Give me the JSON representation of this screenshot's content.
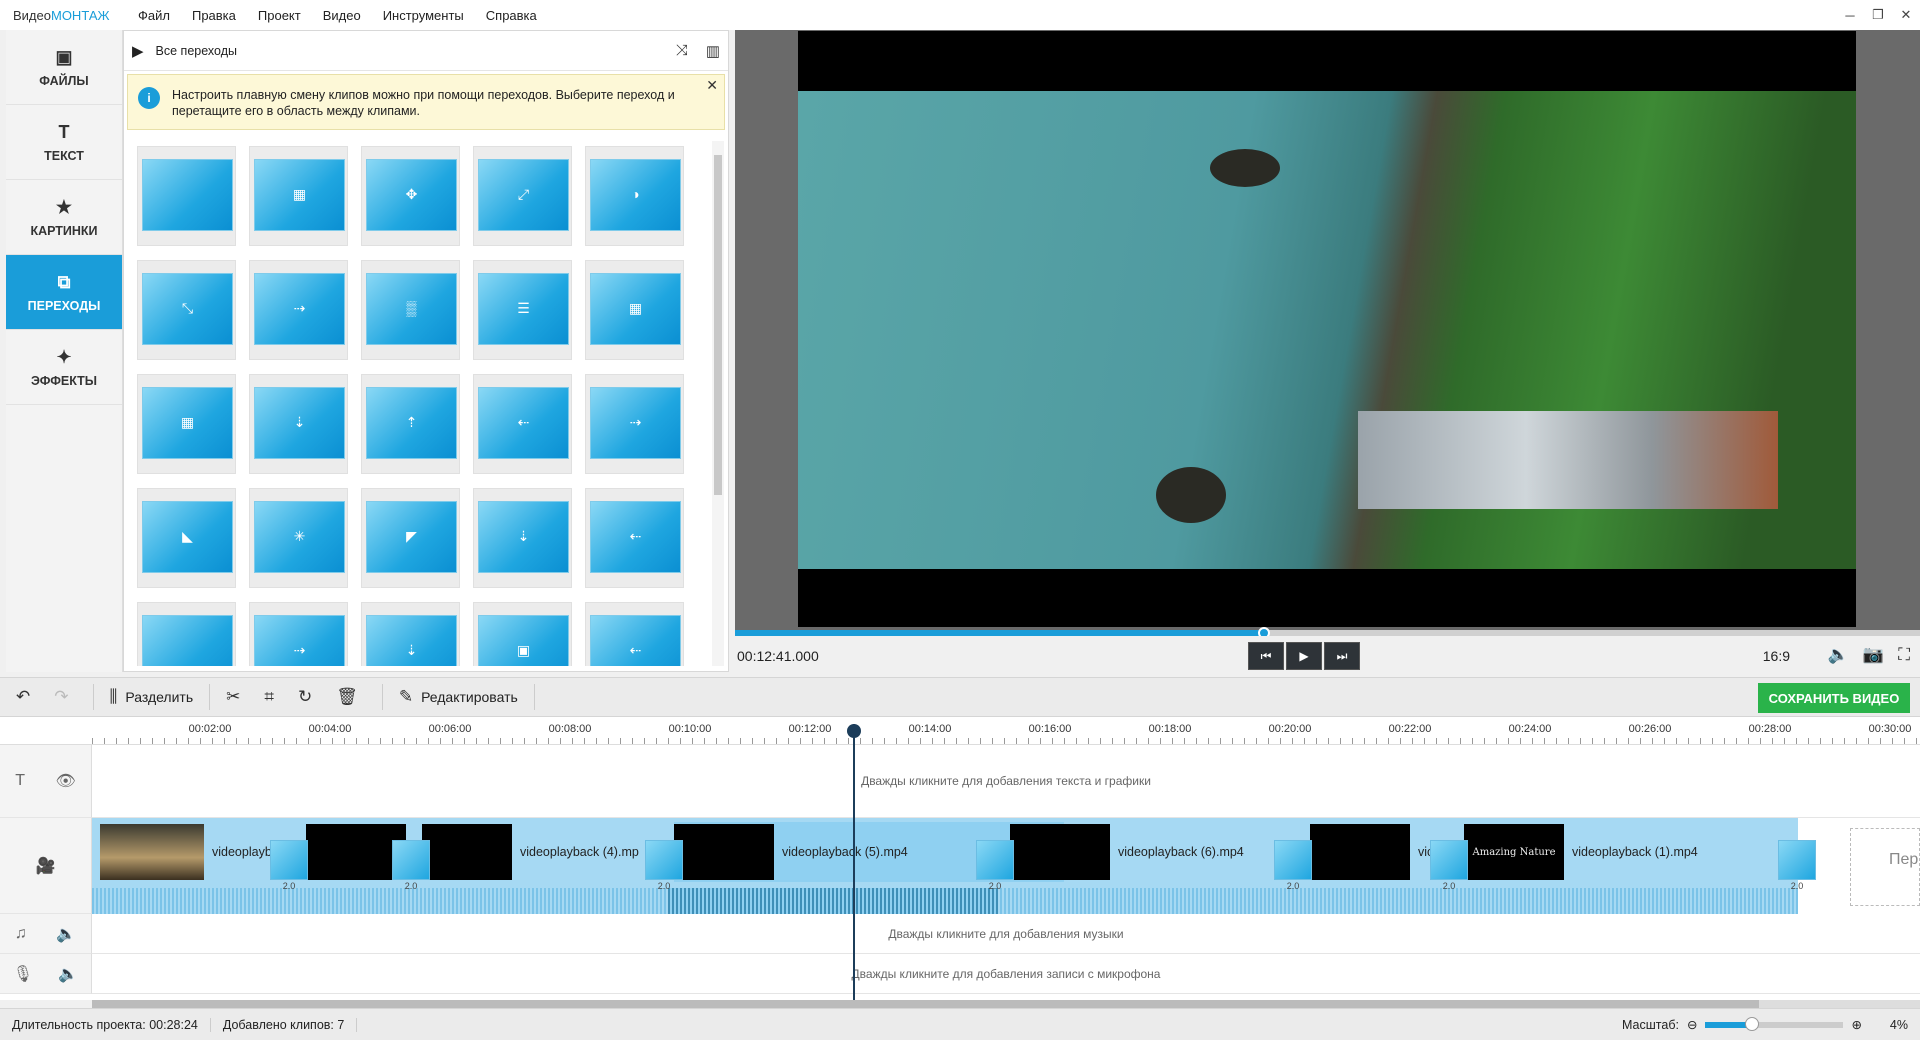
{
  "app": {
    "logo_a": "Видео",
    "logo_b": "МОНТАЖ"
  },
  "menu": [
    "Файл",
    "Правка",
    "Проект",
    "Видео",
    "Инструменты",
    "Справка"
  ],
  "sidebar": [
    {
      "label": "ФАЙЛЫ",
      "icon": "image-icon"
    },
    {
      "label": "ТЕКСТ",
      "icon": "text-icon"
    },
    {
      "label": "КАРТИНКИ",
      "icon": "star-icon"
    },
    {
      "label": "ПЕРЕХОДЫ",
      "icon": "transitions-icon"
    },
    {
      "label": "ЭФФЕКТЫ",
      "icon": "magic-wand-icon"
    }
  ],
  "panel": {
    "header": "Все переходы",
    "info_text": "Настроить плавную смену клипов можно при помощи переходов. Выберите переход и перетащите его в область между клипами."
  },
  "player": {
    "time": "00:12:41.000",
    "ratio": "16:9",
    "progress": 0.45
  },
  "toolbar": {
    "split": "Разделить",
    "edit": "Редактировать",
    "save": "СОХРАНИТЬ ВИДЕО"
  },
  "ruler": [
    "00:02:00",
    "00:04:00",
    "00:06:00",
    "00:08:00",
    "00:10:00",
    "00:12:00",
    "00:14:00",
    "00:16:00",
    "00:18:00",
    "00:20:00",
    "00:22:00",
    "00:24:00",
    "00:26:00",
    "00:28:00",
    "00:30:00"
  ],
  "tracks": {
    "text_hint": "Дважды кликните для добавления текста и графики",
    "music_hint": "Дважды кликните для добавления музыки",
    "mic_hint": "Дважды кликните для добавления записи с микрофона"
  },
  "clips": [
    {
      "name": "videoplayb"
    },
    {
      "name": ""
    },
    {
      "name": "videoplayback (4).mp"
    },
    {
      "name": "videoplayback (5).mp4"
    },
    {
      "name": "videoplayback (6).mp4"
    },
    {
      "name": "vic"
    },
    {
      "name": "videoplayback (1).mp4"
    }
  ],
  "transition_duration": "2.0",
  "ghost_text": "Пер\nвi",
  "status": {
    "duration": "Длительность проекта:  00:28:24",
    "clips": "Добавлено клипов: 7",
    "zoom_label": "Масштаб:",
    "zoom_value": "4%"
  },
  "colors": {
    "accent": "#1a9dd9",
    "save": "#2ab34a"
  }
}
